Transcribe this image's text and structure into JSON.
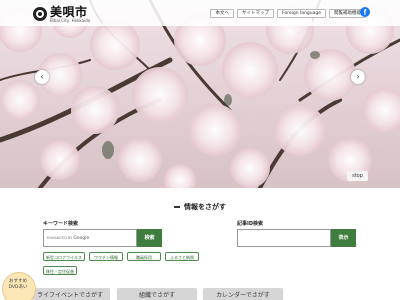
{
  "header": {
    "title": "美唄市",
    "subtitle": "Bibai City, Hokkaido",
    "nav": [
      "本文へ",
      "サイトマップ",
      "Foreign language",
      "閲覧補助機能"
    ],
    "fb_icon": "facebook-icon"
  },
  "hero": {
    "stop_label": "stop",
    "prev_icon": "‹",
    "next_icon": "›"
  },
  "search": {
    "title": "情報をさがす",
    "keyword_label": "キーワード検索",
    "google_prefix": "ENHANCED BY",
    "google_brand": "Google",
    "keyword_button": "検索",
    "article_label": "記事ID検索",
    "article_button": "表示",
    "chips": [
      "新型コロナウイルス",
      "ワクチン情報",
      "職員採用",
      "ふるさと納税",
      "移住・定住促進"
    ]
  },
  "tiles": [
    "ライフイベントでさがす",
    "組織でさがす",
    "カレンダーでさがす"
  ],
  "recommend": {
    "line1": "おすすめ",
    "line2": "DVDあい"
  },
  "colors": {
    "accent_green": "#3f7d3e",
    "facebook_blue": "#1877f2"
  }
}
